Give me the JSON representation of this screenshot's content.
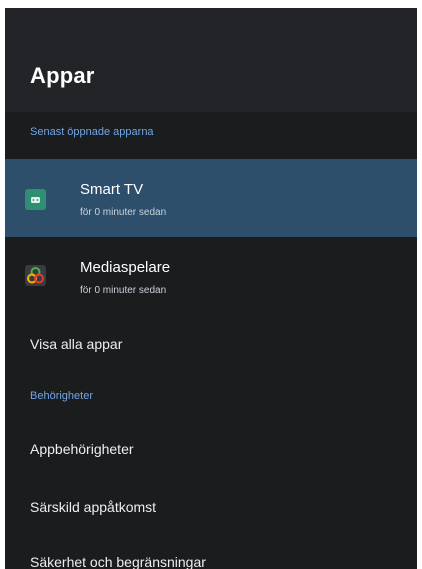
{
  "header": {
    "title": "Appar"
  },
  "recent": {
    "section_label": "Senast öppnade apparna",
    "items": [
      {
        "title": "Smart TV",
        "subtitle": "för 0 minuter sedan",
        "icon": "android-tv-icon",
        "selected": true
      },
      {
        "title": "Mediaspelare",
        "subtitle": "för 0 minuter sedan",
        "icon": "media-player-icon",
        "selected": false
      }
    ]
  },
  "menu": {
    "show_all": "Visa alla appar",
    "permissions_section": "Behörigheter",
    "items": [
      "Appbehörigheter",
      "Särskild appåtkomst",
      "Säkerhet och begränsningar"
    ]
  },
  "colors": {
    "panel_bg": "#1b1c1e",
    "header_bg": "#232427",
    "selected_bg": "#2e4f6c",
    "section_label": "#6fa6e8",
    "smart_tv_icon": "#2e8f72"
  }
}
